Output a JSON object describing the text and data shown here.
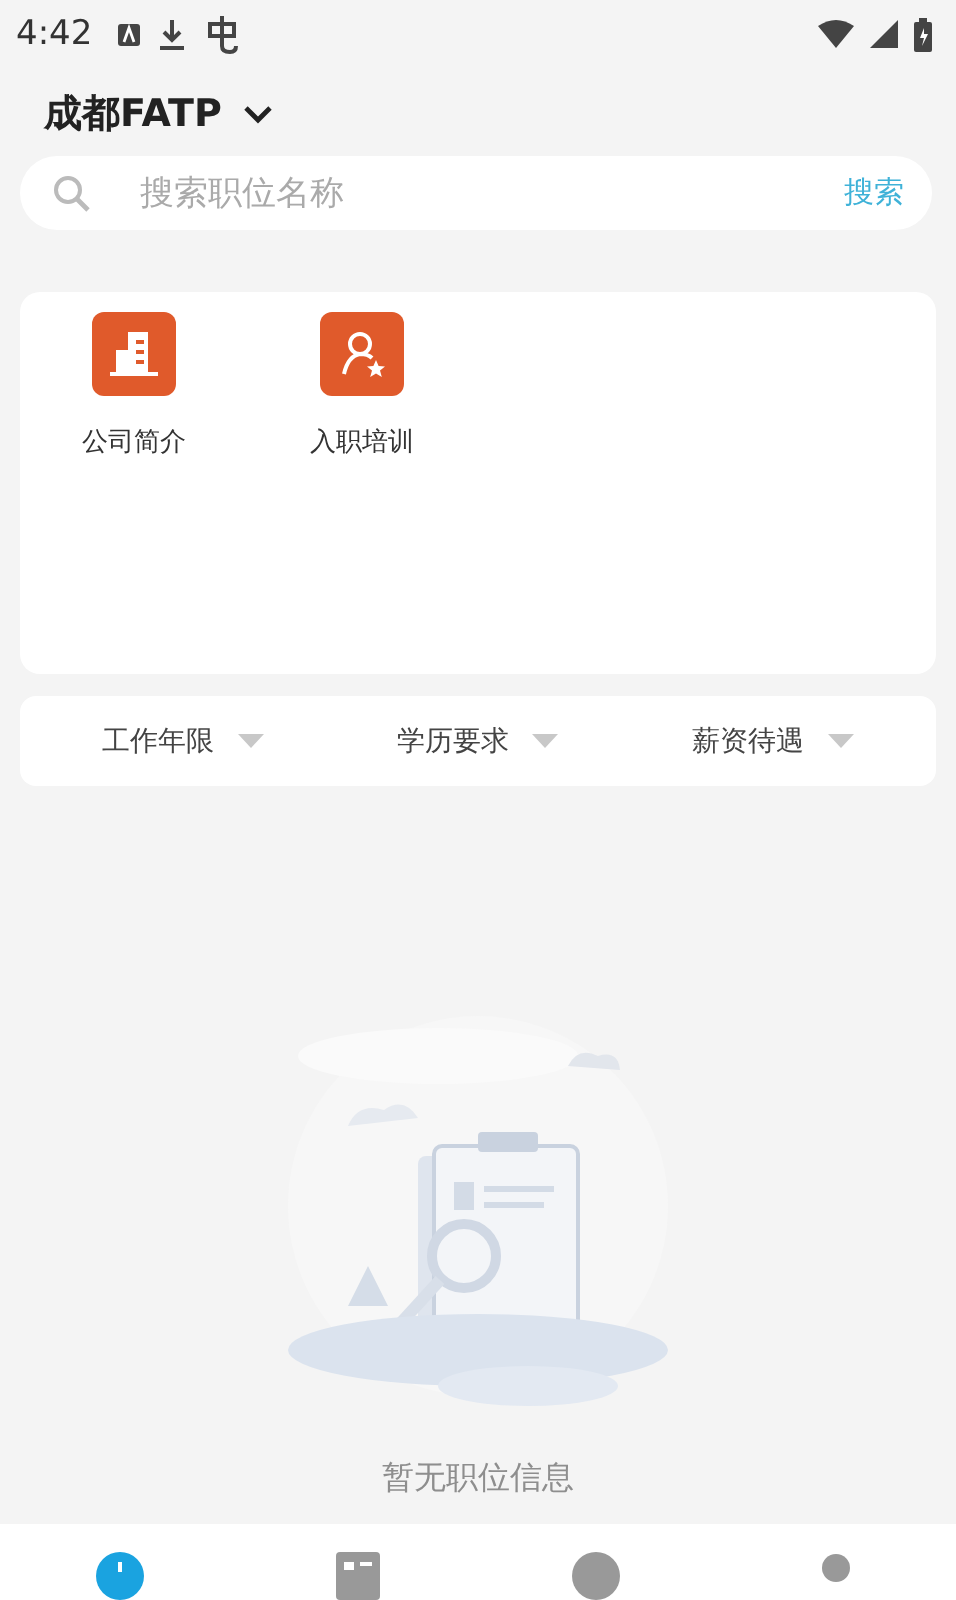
{
  "status_bar": {
    "time": "4:42"
  },
  "header": {
    "city": "成都FATP"
  },
  "search": {
    "placeholder": "搜索职位名称",
    "button": "搜索"
  },
  "shortcuts": [
    {
      "label": "公司简介",
      "kind": "building"
    },
    {
      "label": "入职培训",
      "kind": "training"
    }
  ],
  "filters": [
    "工作年限",
    "学历要求",
    "薪资待遇"
  ],
  "empty_state": {
    "message": "暂无职位信息"
  },
  "bottom_nav": [
    {
      "kind": "home",
      "selected": true
    },
    {
      "kind": "list",
      "selected": false
    },
    {
      "kind": "chat",
      "selected": false
    },
    {
      "kind": "profile",
      "selected": false
    }
  ]
}
